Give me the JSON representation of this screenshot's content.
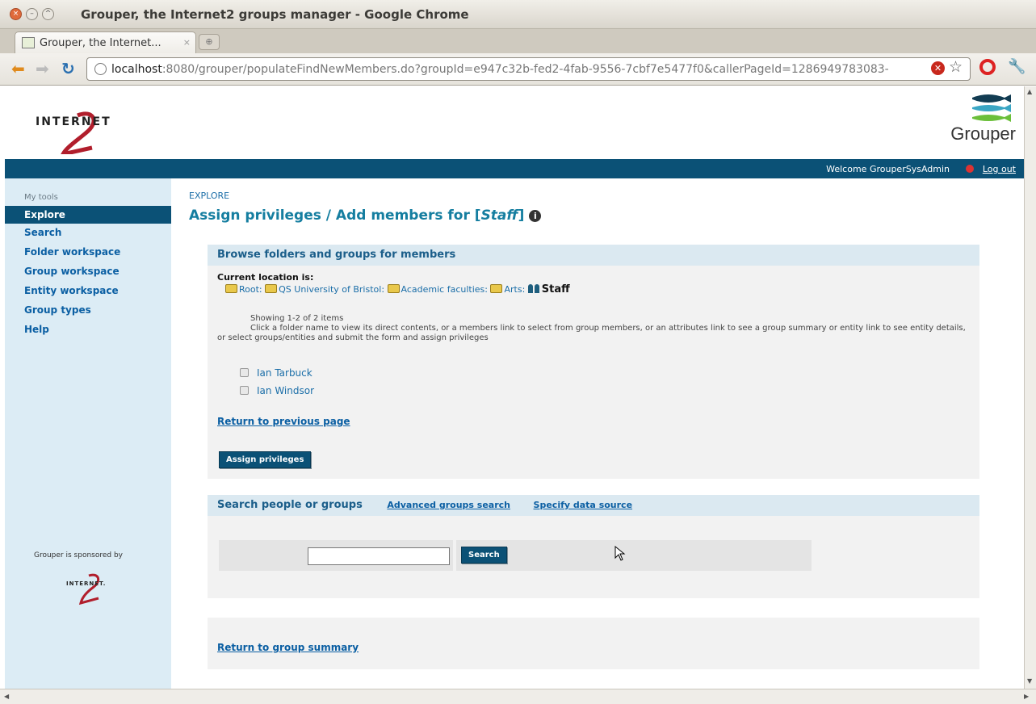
{
  "window": {
    "title": "Grouper, the Internet2 groups manager - Google Chrome"
  },
  "tab": {
    "label": "Grouper, the Internet...",
    "close": "×"
  },
  "address": {
    "host": "localhost",
    "rest": ":8080/grouper/populateFindNewMembers.do?groupId=e947c32b-fed2-4fab-9556-7cbf7e5477f0&callerPageId=1286949783083-"
  },
  "header": {
    "internet2": "INTERNET",
    "grouper": "Grouper"
  },
  "topbar": {
    "welcome": "Welcome GrouperSysAdmin",
    "logout": "Log out"
  },
  "sidebar": {
    "heading": "My tools",
    "items": [
      "Explore",
      "Search",
      "Folder workspace",
      "Group workspace",
      "Entity workspace",
      "Group types",
      "Help"
    ],
    "sponsor": "Grouper is sponsored by"
  },
  "main": {
    "breadcrumb": "EXPLORE",
    "title_prefix": "Assign privileges / Add members for [",
    "title_group": "Staff",
    "title_suffix": "]"
  },
  "browse": {
    "heading": "Browse folders and groups for members",
    "current_label": "Current location is:",
    "path": [
      "Root:",
      "QS University of Bristol:",
      "Academic faculties:",
      "Arts:"
    ],
    "current": "Staff",
    "showing": "Showing 1-2 of 2 items",
    "help": "Click a folder name to view its direct contents, or a members link to select from group members, or an attributes link to see a group summary or entity link to see entity details, or select groups/entities and submit the form and assign privileges",
    "members": [
      "Ian Tarbuck",
      "Ian Windsor"
    ],
    "return_prev": "Return to previous page",
    "assign_button": "Assign privileges"
  },
  "search": {
    "heading": "Search people or groups",
    "advanced": "Advanced groups search",
    "datasource": "Specify data source",
    "input_value": "",
    "button": "Search"
  },
  "footer_box": {
    "return_summary": "Return to group summary"
  }
}
